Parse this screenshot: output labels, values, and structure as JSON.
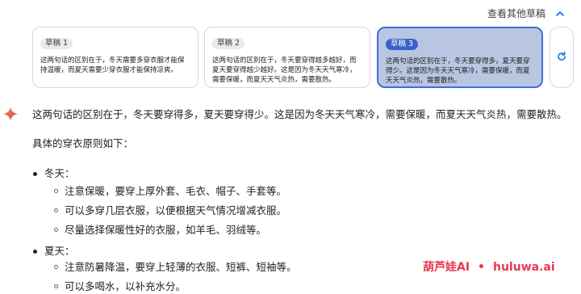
{
  "header": {
    "view_drafts_label": "查看其他草稿",
    "collapse_icon": "chevron-up-icon"
  },
  "drafts": [
    {
      "label": "草稿 1",
      "text": "这两句话的区别在于，冬天需要多穿衣服才能保持温暖，而夏天需要少穿衣服才能保持凉爽。",
      "selected": false
    },
    {
      "label": "草稿 2",
      "text": "这两句话的区别在于，冬天要穿得越多越好，而夏天要穿得越少越好。这是因为冬天天气寒冷，需要保暖，而夏天天气炎热，需要散热。",
      "selected": false
    },
    {
      "label": "草稿 3",
      "text": "这两句话的区别在于，冬天要穿得多，夏天要穿得少。这是因为冬天天气寒冷，需要保暖，而夏天天气炎热，需要散热。",
      "selected": true
    }
  ],
  "refresh_icon": "refresh-icon",
  "response": {
    "icon": "sparkle-icon",
    "paragraph1": "这两句话的区别在于，冬天要穿得多，夏天要穿得少。这是因为冬天天气寒冷，需要保暖，而夏天天气炎热，需要散热。",
    "paragraph2": "具体的穿衣原则如下：",
    "sections": [
      {
        "title": "冬天：",
        "items": [
          "注意保暖，要穿上厚外套、毛衣、帽子、手套等。",
          "可以多穿几层衣服，以便根据天气情况增减衣服。",
          "尽量选择保暖性好的衣服，如羊毛、羽绒等。"
        ]
      },
      {
        "title": "夏天：",
        "items": [
          "注意防暑降温，要穿上轻薄的衣服、短裤、短袖等。",
          "可以多喝水，以补充水分。"
        ]
      }
    ]
  },
  "watermark": {
    "brand": "葫芦娃AI",
    "separator": "•",
    "url": "huluwa.ai"
  },
  "colors": {
    "accent": "#3a63c8",
    "selected_bg": "#b9c6e2",
    "sparkle_blue": "#4285f4",
    "sparkle_orange": "#f29b4f",
    "watermark": "#e53950"
  }
}
